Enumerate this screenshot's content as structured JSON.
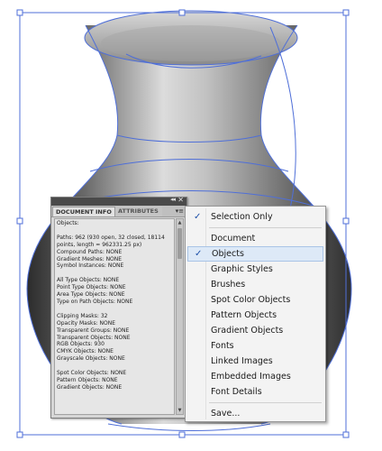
{
  "colors": {
    "selection": "#4f6fd8",
    "menu_highlight": "#dde9f7",
    "panel_bg": "#d6d6d6"
  },
  "document_info_panel": {
    "tabs": [
      "DOCUMENT INFO",
      "ATTRIBUTES"
    ],
    "active_tab": "DOCUMENT INFO",
    "icons": {
      "collapse": "double-chevron-icon",
      "close": "close-icon",
      "panel_menu": "panel-menu-icon"
    },
    "collapse_glyph": "◂◂",
    "close_glyph": "✕",
    "menu_glyph": "▾≡",
    "info_lines": [
      "Objects:",
      "",
      "Paths: 962 (930 open, 32 closed, 18114",
      "points, length = 962331.25 px)",
      "Compound Paths: NONE",
      "Gradient Meshes: NONE",
      "Symbol Instances: NONE",
      "",
      "All Type Objects: NONE",
      "Point Type Objects: NONE",
      "Area Type Objects: NONE",
      "Type on Path Objects: NONE",
      "",
      "Clipping Masks: 32",
      "Opacity Masks: NONE",
      "Transparent Groups: NONE",
      "Transparent Objects: NONE",
      "RGB Objects: 930",
      "CMYK Objects: NONE",
      "Grayscale Objects: NONE",
      "",
      "Spot Color Objects: NONE",
      "Pattern Objects: NONE",
      "Gradient Objects: NONE"
    ]
  },
  "flyout_menu": {
    "check_glyph": "✓",
    "items": [
      {
        "label": "Selection Only",
        "checked": true,
        "highlighted": false
      },
      {
        "separator": true
      },
      {
        "label": "Document",
        "checked": false,
        "highlighted": false
      },
      {
        "label": "Objects",
        "checked": true,
        "highlighted": true
      },
      {
        "label": "Graphic Styles",
        "checked": false,
        "highlighted": false
      },
      {
        "label": "Brushes",
        "checked": false,
        "highlighted": false
      },
      {
        "label": "Spot Color Objects",
        "checked": false,
        "highlighted": false
      },
      {
        "label": "Pattern Objects",
        "checked": false,
        "highlighted": false
      },
      {
        "label": "Gradient Objects",
        "checked": false,
        "highlighted": false
      },
      {
        "label": "Fonts",
        "checked": false,
        "highlighted": false
      },
      {
        "label": "Linked Images",
        "checked": false,
        "highlighted": false
      },
      {
        "label": "Embedded Images",
        "checked": false,
        "highlighted": false
      },
      {
        "label": "Font Details",
        "checked": false,
        "highlighted": false
      },
      {
        "separator": true
      },
      {
        "label": "Save...",
        "checked": false,
        "highlighted": false
      }
    ]
  }
}
